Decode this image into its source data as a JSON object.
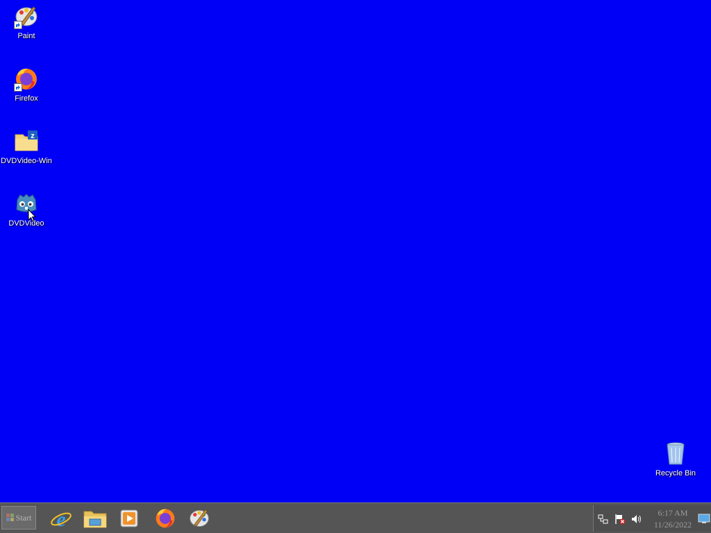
{
  "desktop": {
    "background": "#0000f6",
    "icons": [
      {
        "label": "Paint",
        "icon": "paint-icon",
        "shortcut": true
      },
      {
        "label": "Firefox",
        "icon": "firefox-icon",
        "shortcut": true
      },
      {
        "label": "DVDVideo-Win",
        "icon": "zip-folder-icon",
        "shortcut": false
      },
      {
        "label": "DVDVideo",
        "icon": "godot-icon",
        "shortcut": false
      },
      {
        "label": "Recycle Bin",
        "icon": "recycle-bin-icon",
        "shortcut": false
      }
    ]
  },
  "taskbar": {
    "start_label": "Start",
    "pinned": [
      {
        "name": "Internet Explorer",
        "icon": "internet-explorer-icon"
      },
      {
        "name": "File Explorer",
        "icon": "file-explorer-icon"
      },
      {
        "name": "Media Player",
        "icon": "media-player-icon"
      },
      {
        "name": "Firefox",
        "icon": "firefox-icon"
      },
      {
        "name": "Paint",
        "icon": "paint-icon"
      }
    ],
    "tray": {
      "icons": [
        "network-icon",
        "action-center-flag-icon",
        "volume-icon"
      ],
      "time": "6:17 AM",
      "date": "11/26/2022"
    }
  }
}
